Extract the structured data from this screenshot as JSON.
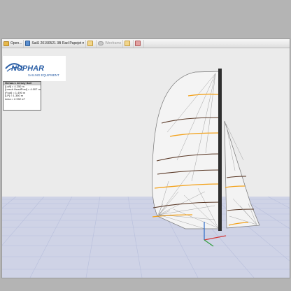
{
  "toolbar": {
    "items": [
      {
        "label": "Open..."
      },
      {
        "label": "SailJ 20190521 3B Rad Papejet ▾"
      },
      {
        "label": "Wireframe"
      }
    ]
  },
  "logo": {
    "wordmark": "NUPHAR",
    "tagline": "SAILING EQUIPMENT"
  },
  "info_panel": {
    "title": "Genoa 1 Jersey Sail",
    "rows": [
      "[Luff] = 4.250 m",
      "[Leech HeadPost] = 4.007 m",
      "[Foot] = 1.490 m",
      "[LP] = 1.350 m",
      "Area = 2.992 m²"
    ]
  },
  "colors": {
    "batten_orange": "#f3a21b",
    "seam_brown": "#5b3a28",
    "mast": "#2e2e2e",
    "floor": "#cfd3e6"
  }
}
